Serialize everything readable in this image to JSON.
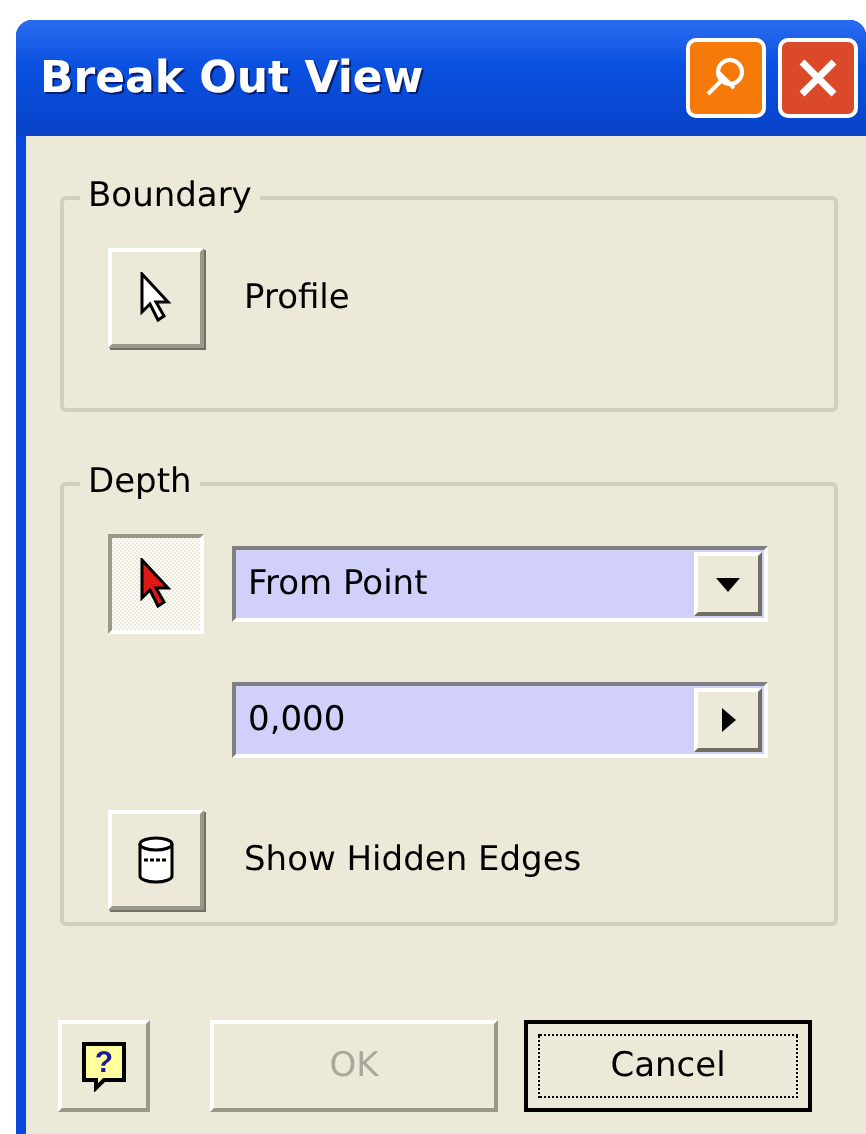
{
  "window": {
    "title": "Break Out View"
  },
  "boundary": {
    "title": "Boundary",
    "pick_button": {
      "pressed": false
    },
    "label": "Profile"
  },
  "depth": {
    "title": "Depth",
    "pick_button": {
      "pressed": true
    },
    "method": {
      "value": "From Point"
    },
    "distance": {
      "value": "0,000"
    },
    "hidden_edges_button": {
      "pressed": false
    },
    "hidden_edges_label": "Show Hidden Edges"
  },
  "buttons": [
    {
      "kind": "help",
      "glyph": "?"
    },
    {
      "kind": "text",
      "label": "OK",
      "disabled": true,
      "default": false
    },
    {
      "kind": "text",
      "label": "Cancel",
      "disabled": false,
      "default": true
    }
  ]
}
